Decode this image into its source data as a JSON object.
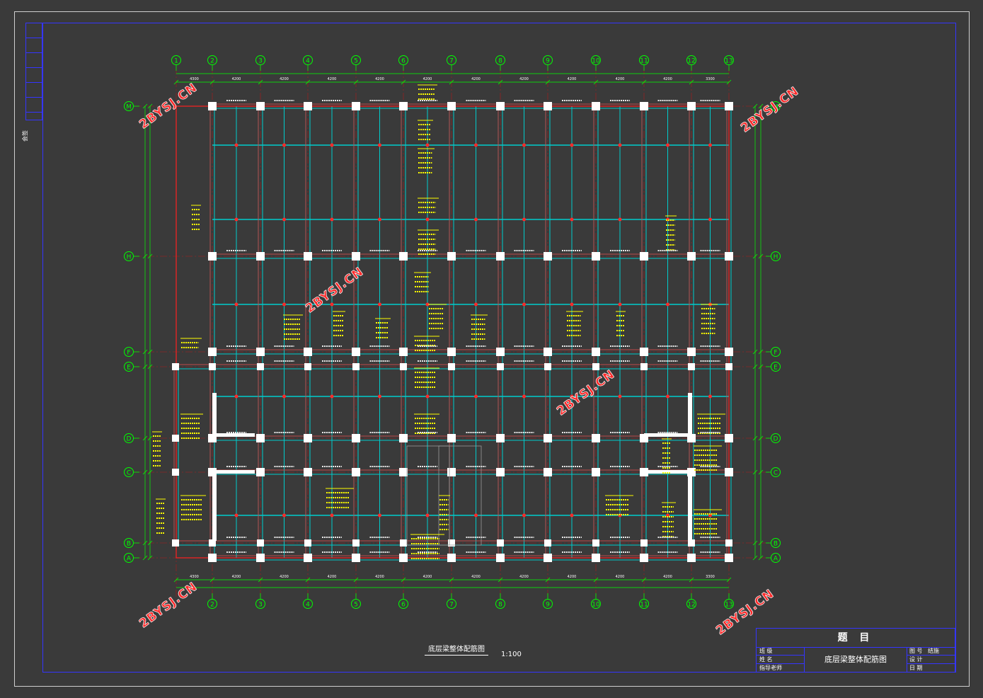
{
  "drawing": {
    "title": "底层梁整体配筋图",
    "scale": "1:100"
  },
  "grid": {
    "columns": [
      "1",
      "2",
      "3",
      "4",
      "5",
      "6",
      "7",
      "8",
      "9",
      "10",
      "11",
      "12",
      "13"
    ],
    "columns_bottom": [
      "2",
      "3",
      "4",
      "5",
      "6",
      "7",
      "8",
      "9",
      "10",
      "11",
      "12",
      "13"
    ],
    "rows": [
      "M",
      "H",
      "F",
      "E",
      "D",
      "C",
      "B",
      "A"
    ],
    "spans_top": [
      "4300",
      "4200",
      "4200",
      "4200",
      "4200",
      "4200",
      "4200",
      "4200",
      "4200",
      "4200",
      "4200",
      "3300"
    ],
    "spans_bottom": [
      "4300",
      "4200",
      "4200",
      "4200",
      "4200",
      "4200",
      "4200",
      "4200",
      "4200",
      "4200",
      "4200",
      "3300"
    ]
  },
  "watermark": "2BYSJ.CN",
  "title_block": {
    "header": "题 目",
    "main_title": "底层梁整体配筋图",
    "left_rows": [
      "班 级",
      "姓 名",
      "指导老师"
    ],
    "right_rows": [
      "图 号",
      "设 计",
      "日 期"
    ],
    "right_values": [
      "结施",
      "",
      ""
    ]
  },
  "side_label": "会签",
  "colors": {
    "background": "#3a3a3a",
    "frame": "#3535ff",
    "grid_circle": "#00ff00",
    "beam": "#00cccc",
    "beam_edge": "#ff2020",
    "annotation": "#ffff00",
    "column": "#ffffff"
  }
}
